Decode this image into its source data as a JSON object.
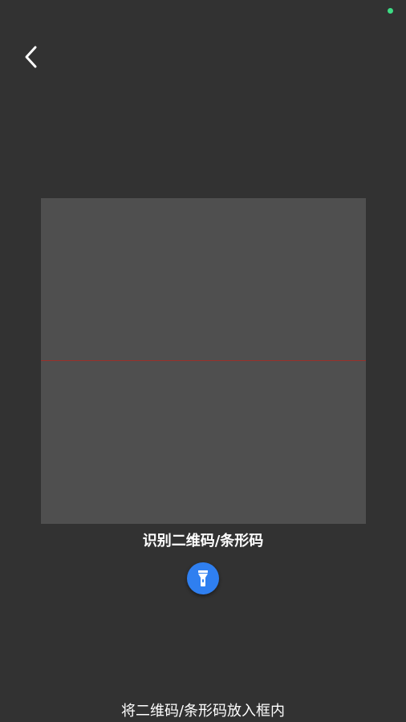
{
  "colors": {
    "background": "#323232",
    "scan_frame": "#4f4f4f",
    "scan_line": "#b3261e",
    "accent": "#2f7ff0",
    "status_indicator": "#3ddc84",
    "text": "#ffffff"
  },
  "header": {
    "back_icon": "chevron-left-icon"
  },
  "scanner": {
    "title": "识别二维码/条形码",
    "flashlight_icon": "flashlight-icon"
  },
  "footer": {
    "hint": "将二维码/条形码放入框内"
  }
}
